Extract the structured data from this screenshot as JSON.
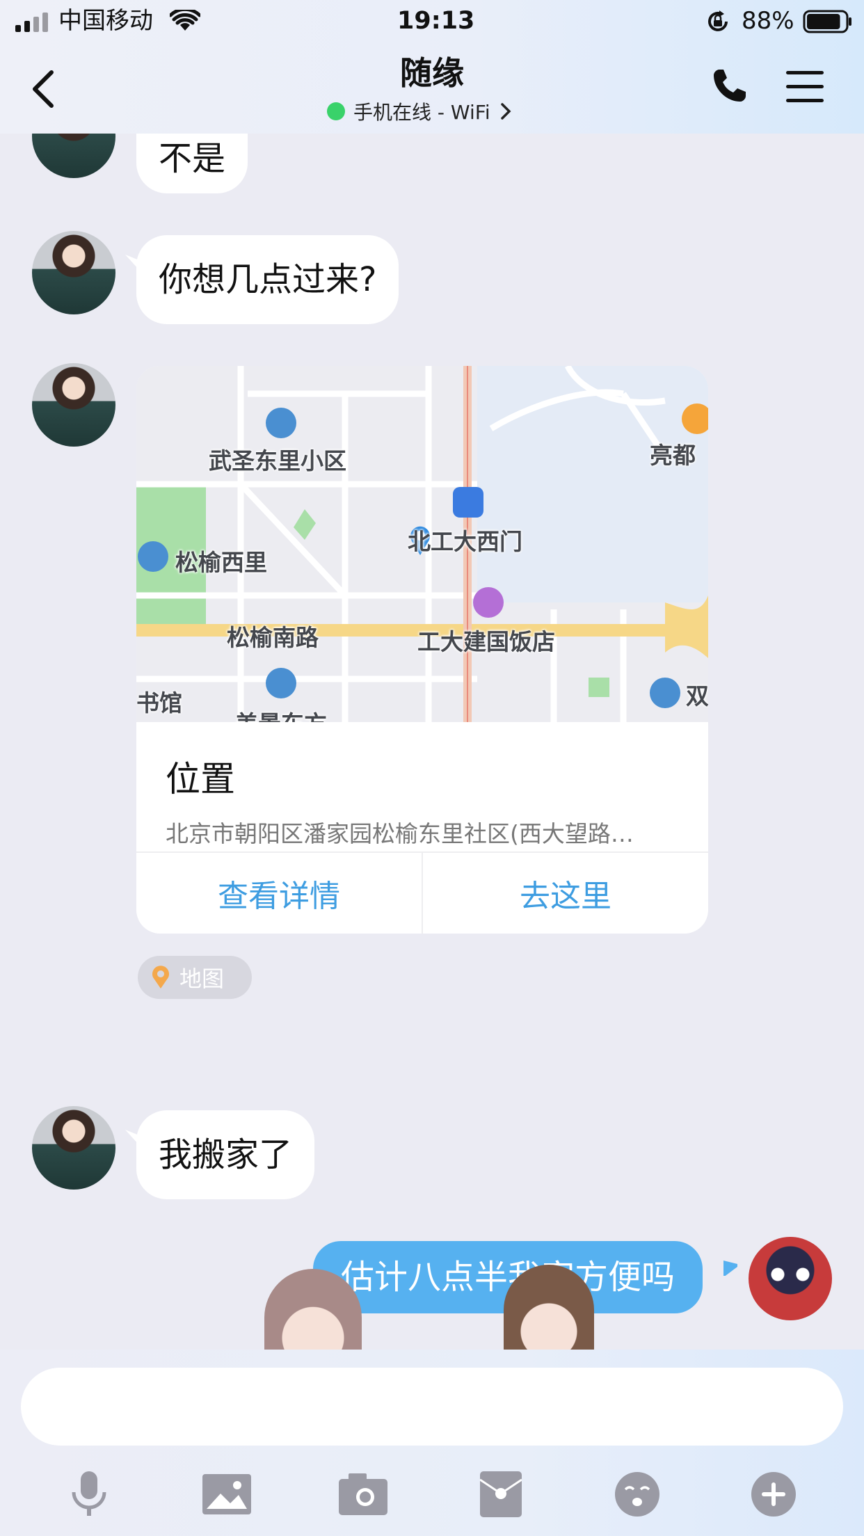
{
  "status_bar": {
    "carrier": "中国移动",
    "time": "19:13",
    "battery_percent": "88%",
    "battery_level": 0.88,
    "icons": [
      "signal-icon",
      "wifi-icon",
      "rotation-lock-icon",
      "battery-icon"
    ]
  },
  "header": {
    "title": "随缘",
    "presence": "手机在线 - WiFi",
    "presence_color": "#39d26a",
    "icons": [
      "back-icon",
      "phone-icon",
      "menu-icon"
    ]
  },
  "messages": [
    {
      "from": "contact",
      "type": "text",
      "text": "不是"
    },
    {
      "from": "contact",
      "type": "text",
      "text": "你想几点过来?"
    },
    {
      "from": "contact",
      "type": "location",
      "map_labels": {
        "wusheng": "武圣东里小区",
        "liangdu": "亮都",
        "gongda_ximen": "北工大西门",
        "songyu_xili": "松榆西里",
        "songyu_nanlu": "松榆南路",
        "hotel": "工大建国饭店",
        "shuguan": "书馆",
        "meishu": "美景东方",
        "shuang": "双"
      },
      "title": "位置",
      "address": "北京市朝阳区潘家园松榆东里社区(西大望路…",
      "actions": [
        "查看详情",
        "去这里"
      ],
      "tag": "地图"
    },
    {
      "from": "contact",
      "type": "text",
      "text": "我搬家了"
    },
    {
      "from": "me",
      "type": "text",
      "text": "估计八点半我家方便吗"
    }
  ],
  "input": {
    "value": ""
  },
  "toolbar": [
    "voice-icon",
    "image-icon",
    "camera-icon",
    "red-packet-icon",
    "emoji-icon",
    "plus-icon"
  ],
  "colors": {
    "bubble_sent": "#56b1f0",
    "bubble_received": "#ffffff",
    "link": "#3e9de1",
    "background": "#ebebf3"
  }
}
